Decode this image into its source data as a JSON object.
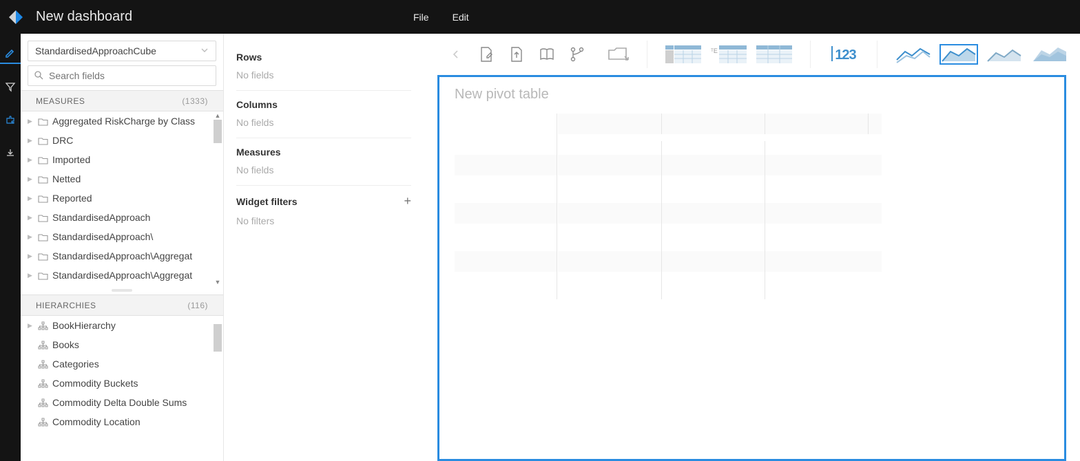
{
  "header": {
    "title": "New dashboard",
    "menu_file": "File",
    "menu_edit": "Edit"
  },
  "fields": {
    "cube_selected": "StandardisedApproachCube",
    "search_placeholder": "Search fields",
    "measures_label": "MEASURES",
    "measures_count": "(1333)",
    "measure_items": [
      "Aggregated RiskCharge by Class",
      "DRC",
      "Imported",
      "Netted",
      "Reported",
      "StandardisedApproach",
      "StandardisedApproach\\",
      "StandardisedApproach\\Aggregat",
      "StandardisedApproach\\Aggregat"
    ],
    "hierarchies_label": "HIERARCHIES",
    "hierarchies_count": "(116)",
    "hierarchy_items": [
      "BookHierarchy",
      "Books",
      "Categories",
      "Commodity Buckets",
      "Commodity Delta Double Sums",
      "Commodity Location"
    ]
  },
  "dropzones": {
    "rows_label": "Rows",
    "rows_empty": "No fields",
    "columns_label": "Columns",
    "columns_empty": "No fields",
    "measures_label": "Measures",
    "measures_empty": "No fields",
    "filters_label": "Widget filters",
    "filters_empty": "No filters"
  },
  "canvas": {
    "pivot_title": "New pivot table",
    "number_label": "123"
  }
}
